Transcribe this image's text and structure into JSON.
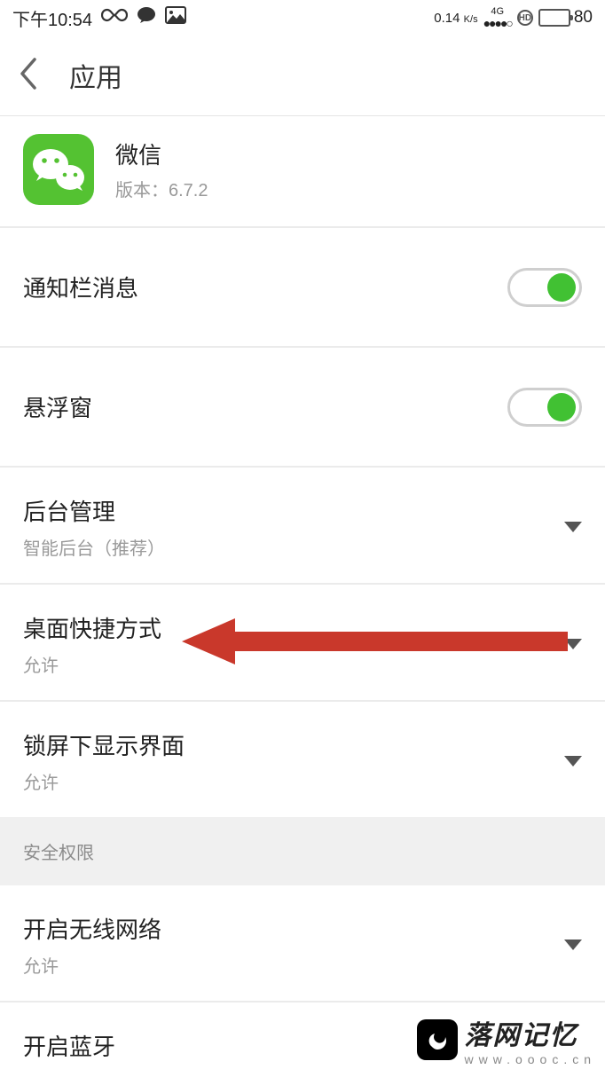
{
  "status_bar": {
    "time": "下午10:54",
    "infinity_icon": "infinity-icon",
    "chat_icon": "chat-icon",
    "image_icon": "image-icon",
    "speed": "0.14",
    "speed_unit": "K/s",
    "network_top": "4G",
    "network_bottom": "●●●●○",
    "hd": "HD",
    "battery_level": "80"
  },
  "nav": {
    "title": "应用"
  },
  "app": {
    "name": "微信",
    "version": "版本：6.7.2"
  },
  "rows": {
    "notif": {
      "title": "通知栏消息"
    },
    "float": {
      "title": "悬浮窗"
    },
    "bg": {
      "title": "后台管理",
      "sub": "智能后台（推荐）"
    },
    "shortcut": {
      "title": "桌面快捷方式",
      "sub": "允许"
    },
    "lockscreen": {
      "title": "锁屏下显示界面",
      "sub": "允许"
    },
    "wifi": {
      "title": "开启无线网络",
      "sub": "允许"
    },
    "bluetooth": {
      "title": "开启蓝牙"
    }
  },
  "section": {
    "security": "安全权限"
  },
  "watermark": {
    "main": "落网记忆",
    "sub": "www.oooc.cn"
  },
  "colors": {
    "accent_green": "#41c133",
    "wechat_green": "#54c232",
    "battery_yellow": "#f5c734",
    "arrow_red": "#c9382b"
  }
}
